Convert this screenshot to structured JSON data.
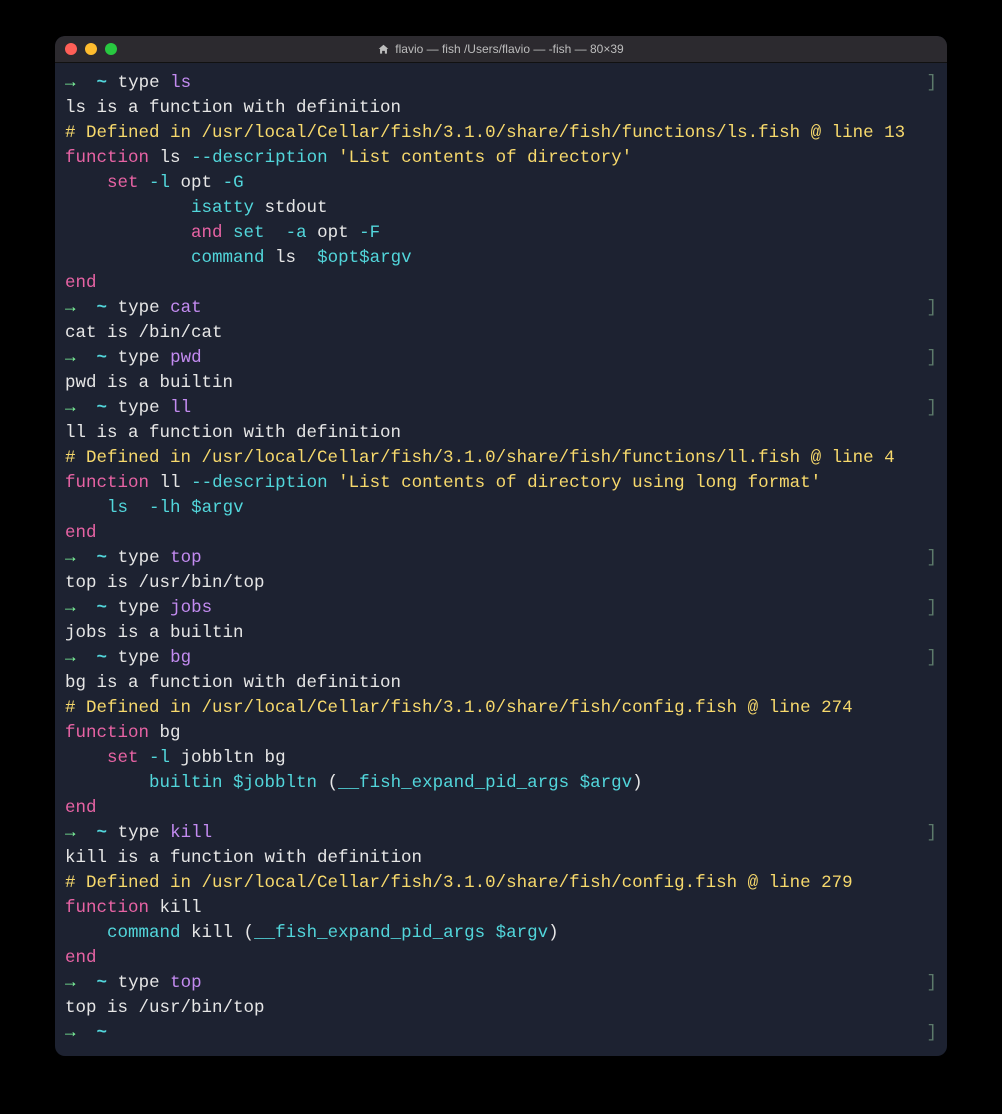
{
  "titlebar": {
    "title": "flavio — fish /Users/flavio — -fish — 80×39"
  },
  "colors": {
    "close": "#ff5f57",
    "min": "#febc2e",
    "max": "#28c840",
    "prompt_arrow": "#7efc9e",
    "prompt_tilde": "#52d6db",
    "arg": "#c38bf0",
    "comment": "#f7d96c",
    "keyword": "#e763a4",
    "option": "#52d6db",
    "variable": "#52d6db",
    "text": "#e6e6e6"
  },
  "session": [
    {
      "type": "prompt",
      "cmd": "type",
      "arg": "ls",
      "out": [
        {
          "type": "plain",
          "text": "ls is a function with definition"
        },
        {
          "type": "comment",
          "text": "# Defined in /usr/local/Cellar/fish/3.1.0/share/fish/functions/ls.fish @ line 13"
        },
        {
          "type": "func",
          "kw": "function",
          "name": "ls",
          "opt": "--description",
          "desc": "'List contents of directory'"
        },
        {
          "type": "body",
          "indent": "    ",
          "kw": "set",
          "opts": "-l",
          "tail1": " opt ",
          "tail2": "-G"
        },
        {
          "type": "body",
          "indent": "            ",
          "sub": "isatty",
          "tail": " stdout"
        },
        {
          "type": "body",
          "indent": "            ",
          "kw": "and",
          "sub": " set",
          "opts": " -a",
          "tail1": " opt ",
          "tail2": "-F"
        },
        {
          "type": "body",
          "indent": "            ",
          "sub": "command",
          "tail_cmd": " ls ",
          "var1": "$opt",
          "sp": " ",
          "var2": "$argv"
        },
        {
          "type": "end",
          "text": "end"
        }
      ]
    },
    {
      "type": "prompt",
      "cmd": "type",
      "arg": "cat",
      "out": [
        {
          "type": "plain",
          "text": "cat is /bin/cat"
        }
      ]
    },
    {
      "type": "prompt",
      "cmd": "type",
      "arg": "pwd",
      "out": [
        {
          "type": "plain",
          "text": "pwd is a builtin"
        }
      ]
    },
    {
      "type": "prompt",
      "cmd": "type",
      "arg": "ll",
      "out": [
        {
          "type": "plain",
          "text": "ll is a function with definition"
        },
        {
          "type": "comment",
          "text": "# Defined in /usr/local/Cellar/fish/3.1.0/share/fish/functions/ll.fish @ line 4"
        },
        {
          "type": "func",
          "kw": "function",
          "name": "ll",
          "opt": "--description",
          "desc": "'List contents of directory using long format'"
        },
        {
          "type": "body",
          "indent": "    ",
          "sub": "ls",
          "opts": " -lh",
          "sp": " ",
          "var1": "$argv"
        },
        {
          "type": "end",
          "text": "end"
        }
      ]
    },
    {
      "type": "prompt",
      "cmd": "type",
      "arg": "top",
      "out": [
        {
          "type": "plain",
          "text": "top is /usr/bin/top"
        }
      ]
    },
    {
      "type": "prompt",
      "cmd": "type",
      "arg": "jobs",
      "out": [
        {
          "type": "plain",
          "text": "jobs is a builtin"
        }
      ]
    },
    {
      "type": "prompt",
      "cmd": "type",
      "arg": "bg",
      "out": [
        {
          "type": "plain",
          "text": "bg is a function with definition"
        },
        {
          "type": "comment",
          "text": "# Defined in /usr/local/Cellar/fish/3.1.0/share/fish/config.fish @ line 274"
        },
        {
          "type": "func",
          "kw": "function",
          "name": "bg"
        },
        {
          "type": "body",
          "indent": "    ",
          "kw": "set",
          "opts": "-l",
          "tail1": " jobbltn bg"
        },
        {
          "type": "body",
          "indent": "        ",
          "sub": "builtin",
          "sp": " ",
          "var1": "$jobbltn",
          "sp2": " ",
          "paren_open": "(",
          "fn_call": "__fish_expand_pid_args",
          "sp3": " ",
          "var2": "$argv",
          "paren_close": ")"
        },
        {
          "type": "end",
          "text": "end"
        }
      ]
    },
    {
      "type": "prompt",
      "cmd": "type",
      "arg": "kill",
      "out": [
        {
          "type": "plain",
          "text": "kill is a function with definition"
        },
        {
          "type": "comment",
          "text": "# Defined in /usr/local/Cellar/fish/3.1.0/share/fish/config.fish @ line 279"
        },
        {
          "type": "func",
          "kw": "function",
          "name": "kill"
        },
        {
          "type": "body",
          "indent": "    ",
          "sub": "command",
          "tail_cmd": " kill ",
          "paren_open": "(",
          "fn_call": "__fish_expand_pid_args",
          "sp3": " ",
          "var2": "$argv",
          "paren_close": ")"
        },
        {
          "type": "end",
          "text": "end"
        }
      ]
    },
    {
      "type": "prompt",
      "cmd": "type",
      "arg": "top",
      "out": [
        {
          "type": "plain",
          "text": "top is /usr/bin/top"
        }
      ]
    },
    {
      "type": "prompt",
      "cmd": "",
      "arg": "",
      "out": []
    }
  ]
}
